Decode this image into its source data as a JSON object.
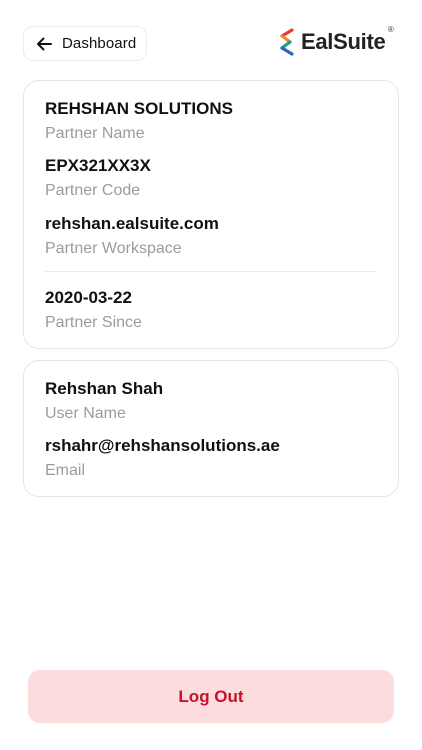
{
  "header": {
    "back_label": "Dashboard",
    "back_icon": "arrow-left-icon",
    "brand_name": "EalSuite",
    "brand_reg": "®",
    "brand_colors": [
      "#e23b3b",
      "#f08a24",
      "#1f9d8a",
      "#2b6cb0"
    ]
  },
  "partner_card": {
    "partner_name": {
      "value": "REHSHAN SOLUTIONS",
      "caption": "Partner Name"
    },
    "partner_code": {
      "value": "EPX321XX3X",
      "caption": "Partner Code"
    },
    "partner_workspace": {
      "value": "rehshan.ealsuite.com",
      "caption": "Partner Workspace"
    },
    "partner_since": {
      "value": "2020-03-22",
      "caption": "Partner Since"
    }
  },
  "user_card": {
    "user_name": {
      "value": "Rehshan Shah",
      "caption": "User Name"
    },
    "email": {
      "value": "rshahr@rehshansolutions.ae",
      "caption": "Email"
    }
  },
  "logout": {
    "label": "Log Out",
    "background": "#fcdcdc",
    "text_color": "#c8102e"
  }
}
